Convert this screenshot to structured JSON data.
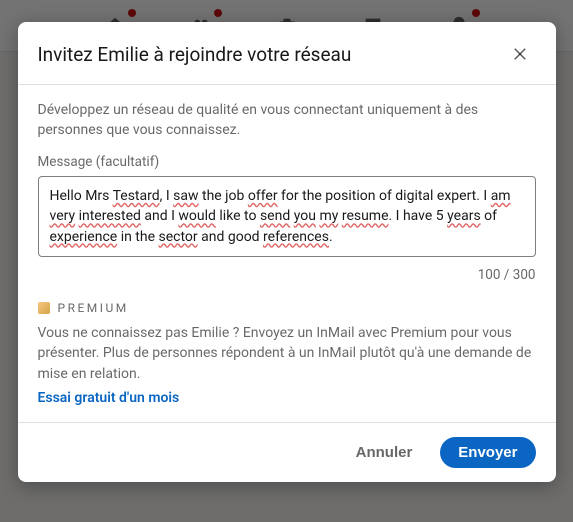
{
  "modal": {
    "title": "Invitez Emilie à rejoindre votre réseau",
    "intro": "Développez un réseau de qualité en vous connectant uniquement à des personnes que vous connaissez.",
    "message_label": "Message (facultatif)",
    "message_value": "Hello Mrs Testard, I saw the job offer for the position of digital expert. I am very interested and I would like to send you my resume. I have 5 years of experience in the sector and good references.",
    "message_words": [
      "Hello",
      " Mrs ",
      "Testard",
      ", I ",
      "saw",
      " the job ",
      "offer",
      " for the position of digital expert. I ",
      "am",
      " ",
      "very",
      " ",
      "interested",
      " and I ",
      "would",
      " like to ",
      "send",
      " ",
      "you",
      " ",
      "my",
      " ",
      "resume",
      ". I have 5 ",
      "years",
      " of ",
      "experience",
      " in the ",
      "sector",
      " and good ",
      "references",
      "."
    ],
    "message_flags": [
      false,
      false,
      true,
      false,
      true,
      false,
      true,
      false,
      true,
      false,
      true,
      false,
      true,
      false,
      true,
      false,
      true,
      false,
      true,
      false,
      true,
      false,
      true,
      false,
      true,
      false,
      true,
      false,
      true,
      false,
      true,
      false
    ],
    "count_current": "100",
    "count_max": "300",
    "premium_label": "PREMIUM",
    "premium_text": "Vous ne connaissez pas Emilie ? Envoyez un InMail avec Premium pour vous présenter. Plus de personnes répondent à un InMail plutôt qu'à une demande de mise en relation.",
    "premium_cta": "Essai gratuit d'un mois",
    "cancel": "Annuler",
    "send": "Envoyer"
  }
}
